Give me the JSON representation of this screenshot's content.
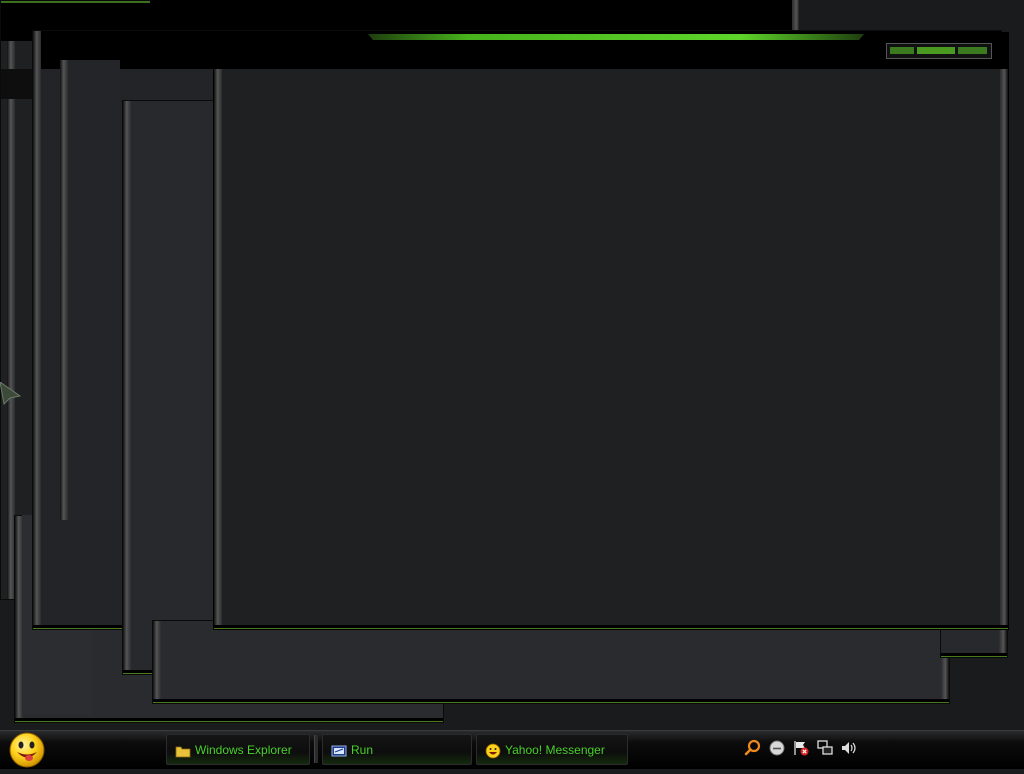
{
  "taskbar": {
    "start_button": {
      "icon": "yahoo-smiley-icon"
    },
    "tasks": [
      {
        "label": "Windows Explorer",
        "icon": "folder-icon",
        "active": true
      },
      {
        "label": "Run",
        "icon": "run-icon",
        "active": false
      },
      {
        "label": "Yahoo! Messenger",
        "icon": "yahoo-smiley-icon",
        "active": false
      }
    ],
    "tray_icons": [
      "search-icon",
      "messenger-status-icon",
      "security-alert-flag-icon",
      "network-icon",
      "volume-icon"
    ]
  },
  "colors": {
    "accent_green": "#48d12a",
    "window_bg": "#26272a",
    "desktop_bg": "#1a1b1d"
  }
}
